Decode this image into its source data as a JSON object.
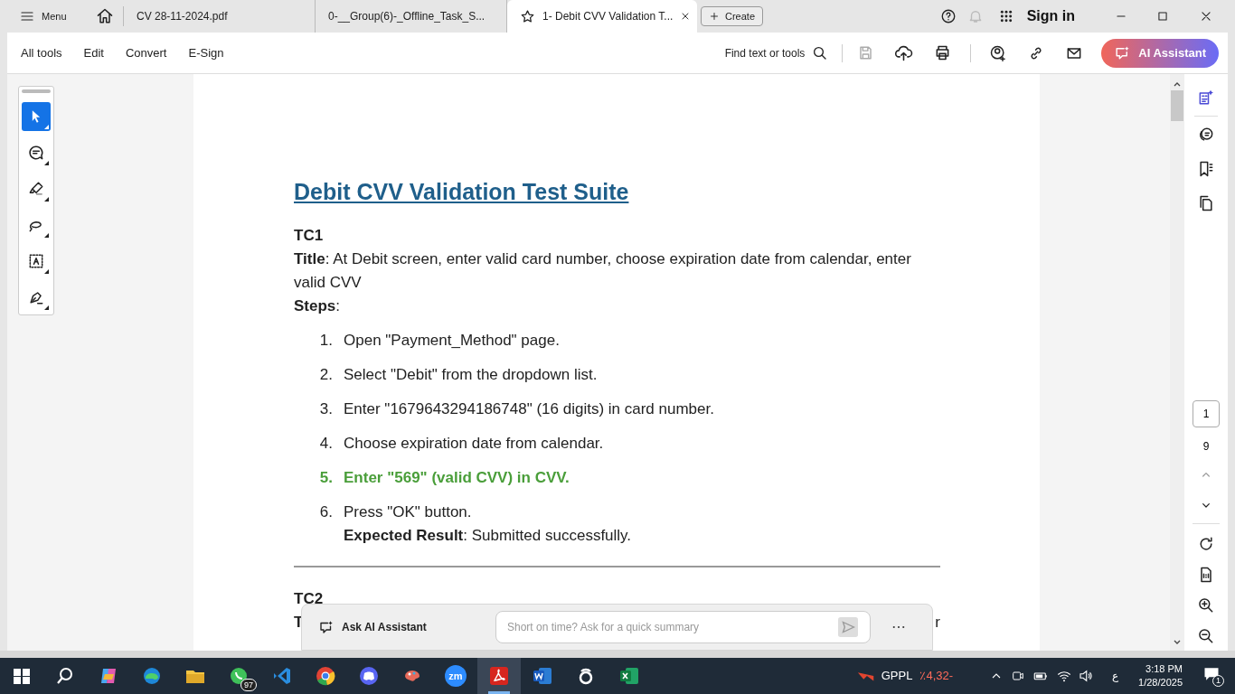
{
  "titlebar": {
    "menu_label": "Menu",
    "tabs": [
      {
        "label": "CV 28-11-2024.pdf",
        "selected": false
      },
      {
        "label": "0-__Group(6)-_Offline_Task_S...",
        "selected": false
      },
      {
        "label": "1- Debit CVV Validation T...",
        "selected": true
      }
    ],
    "create_label": "Create",
    "sign_in": "Sign in"
  },
  "toolbar": {
    "menus": [
      "All tools",
      "Edit",
      "Convert",
      "E-Sign"
    ],
    "find_label": "Find text or tools",
    "ai_button": "AI Assistant"
  },
  "left_tools": [
    {
      "selected": true
    },
    {
      "selected": false
    },
    {
      "selected": false
    },
    {
      "selected": false
    },
    {
      "selected": false
    },
    {
      "selected": false
    }
  ],
  "document": {
    "heading": "Debit CVV Validation Test Suite",
    "case_id": "TC1",
    "title_line": "**Title**: At Debit screen, enter valid card number, choose expiration date from calendar, enter valid CVV",
    "steps_label": "**Steps**:",
    "steps": [
      {
        "number": "1.",
        "text": "Open \"Payment_Method\" page.",
        "highlighted": false
      },
      {
        "number": "2.",
        "text": "Select \"Debit\" from the dropdown list.",
        "highlighted": false
      },
      {
        "number": "3.",
        "text": "Enter \"1679643294186748\" (16 digits) in card number.",
        "highlighted": false
      },
      {
        "number": "4.",
        "text": "Choose expiration date from calendar.",
        "highlighted": false
      },
      {
        "number": "5.",
        "text": "Enter \"569\" (valid CVV) in CVV.",
        "highlighted": true
      },
      {
        "number": "6.",
        "text": "Press \"OK\" button.",
        "highlighted": false,
        "note": "**Expected Result**: Submitted successfully."
      }
    ],
    "next_case_id": "TC2",
    "cut_fragments": [
      "T",
      "r"
    ]
  },
  "ai_bar": {
    "label": "Ask AI Assistant",
    "placeholder": "Short on time? Ask for a quick summary"
  },
  "page_nav": {
    "current": "1",
    "total": "9"
  },
  "taskbar": {
    "whatsapp_badge": "97",
    "zoom_label": "zm",
    "stock_name": "GPPL",
    "stock_change": "٪4,32-",
    "language": "ع",
    "time": "3:18 PM",
    "date": "1/28/2025",
    "notifications": "1"
  }
}
